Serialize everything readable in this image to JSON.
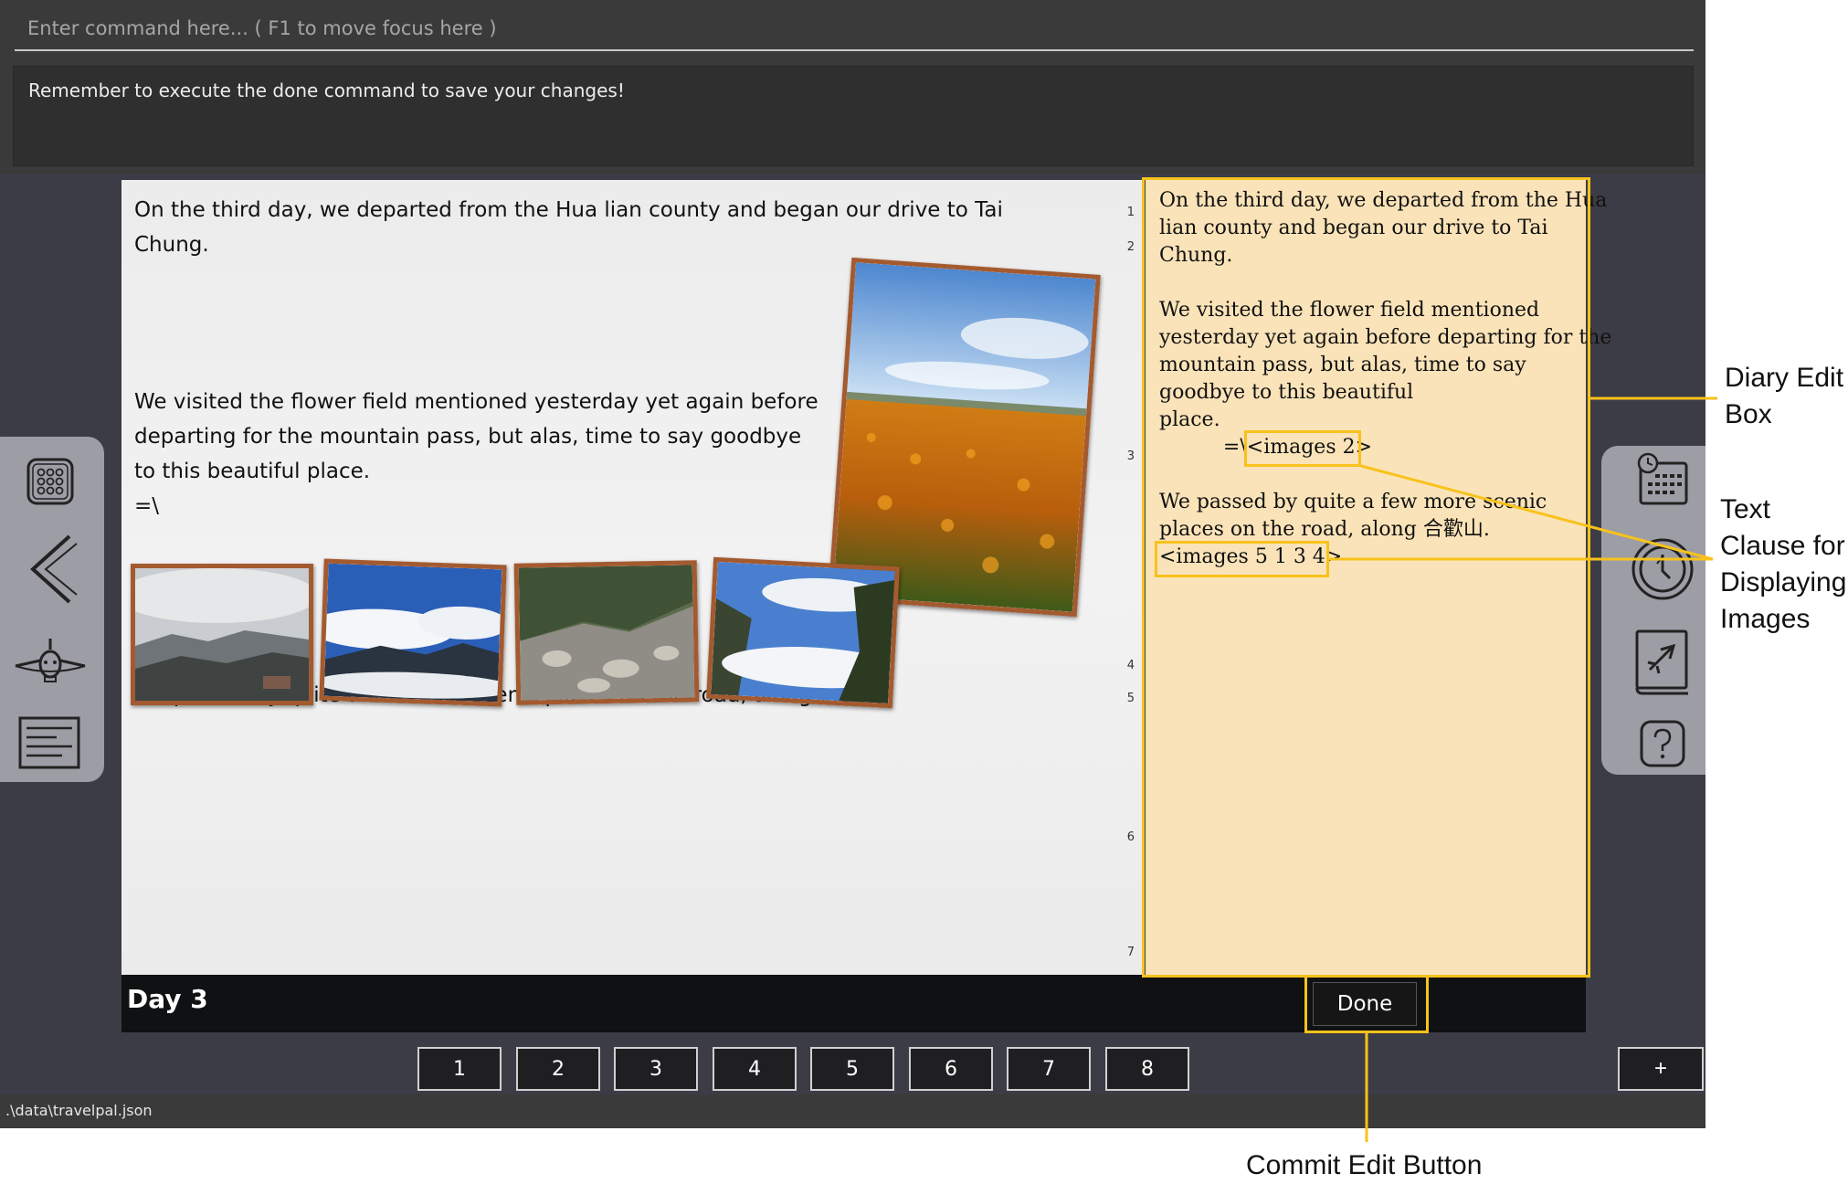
{
  "command": {
    "placeholder": "Enter command here... ( F1 to move focus here )",
    "feedback": "Remember to execute the done command to save your changes!"
  },
  "left_sidebar": {
    "icons": [
      "calendar-grid-icon",
      "back-chevron-icon",
      "airplane-icon",
      "list-icon"
    ]
  },
  "right_sidebar": {
    "icons": [
      "calendar-clock-icon",
      "timer-icon",
      "travel-book-icon",
      "help-icon"
    ]
  },
  "diary": {
    "paragraphs": [
      "On the third day, we departed from the Hua lian county and began our drive to Tai Chung.",
      "We visited the flower field mentioned yesterday yet again before departing for the mountain pass, but alas, time to say goodbye to this beautiful place.",
      "=\\",
      "We passed by quite a few more scenic places on the road, along 合歡山."
    ],
    "line_numbers": [
      "1",
      "2",
      "3",
      "4",
      "5",
      "6",
      "7"
    ],
    "photos": [
      "flower-field-photo",
      "cloudy-mountain-photo",
      "blue-sky-mountain-photo",
      "rocky-riverbed-photo",
      "sea-of-clouds-photo"
    ],
    "day_title": "Day 3"
  },
  "edit_box": {
    "lines": [
      "On the third day, we departed from the Hua",
      "lian county and began our drive to Tai",
      "Chung.",
      "",
      "We visited the flower field mentioned",
      "yesterday yet again before departing for the",
      "mountain pass, but alas, time to say",
      "goodbye to this beautiful",
      "place.",
      "          =\\<images 2>",
      "",
      "We passed by quite a few more scenic",
      "places on the road, along 合歡山.",
      "<images 5 1 3 4>"
    ]
  },
  "done_button": "Done",
  "nav": {
    "pages": [
      "1",
      "2",
      "3",
      "4",
      "5",
      "6",
      "7",
      "8"
    ],
    "add": "+"
  },
  "status_bar": ".\\data\\travelpal.json",
  "annotations": {
    "edit_box": [
      "Diary Edit",
      "Box"
    ],
    "text_clause": [
      "Text",
      "Clause for",
      "Displaying",
      "Images"
    ],
    "commit_button": "Commit Edit Button",
    "color": "#f7c21b"
  }
}
